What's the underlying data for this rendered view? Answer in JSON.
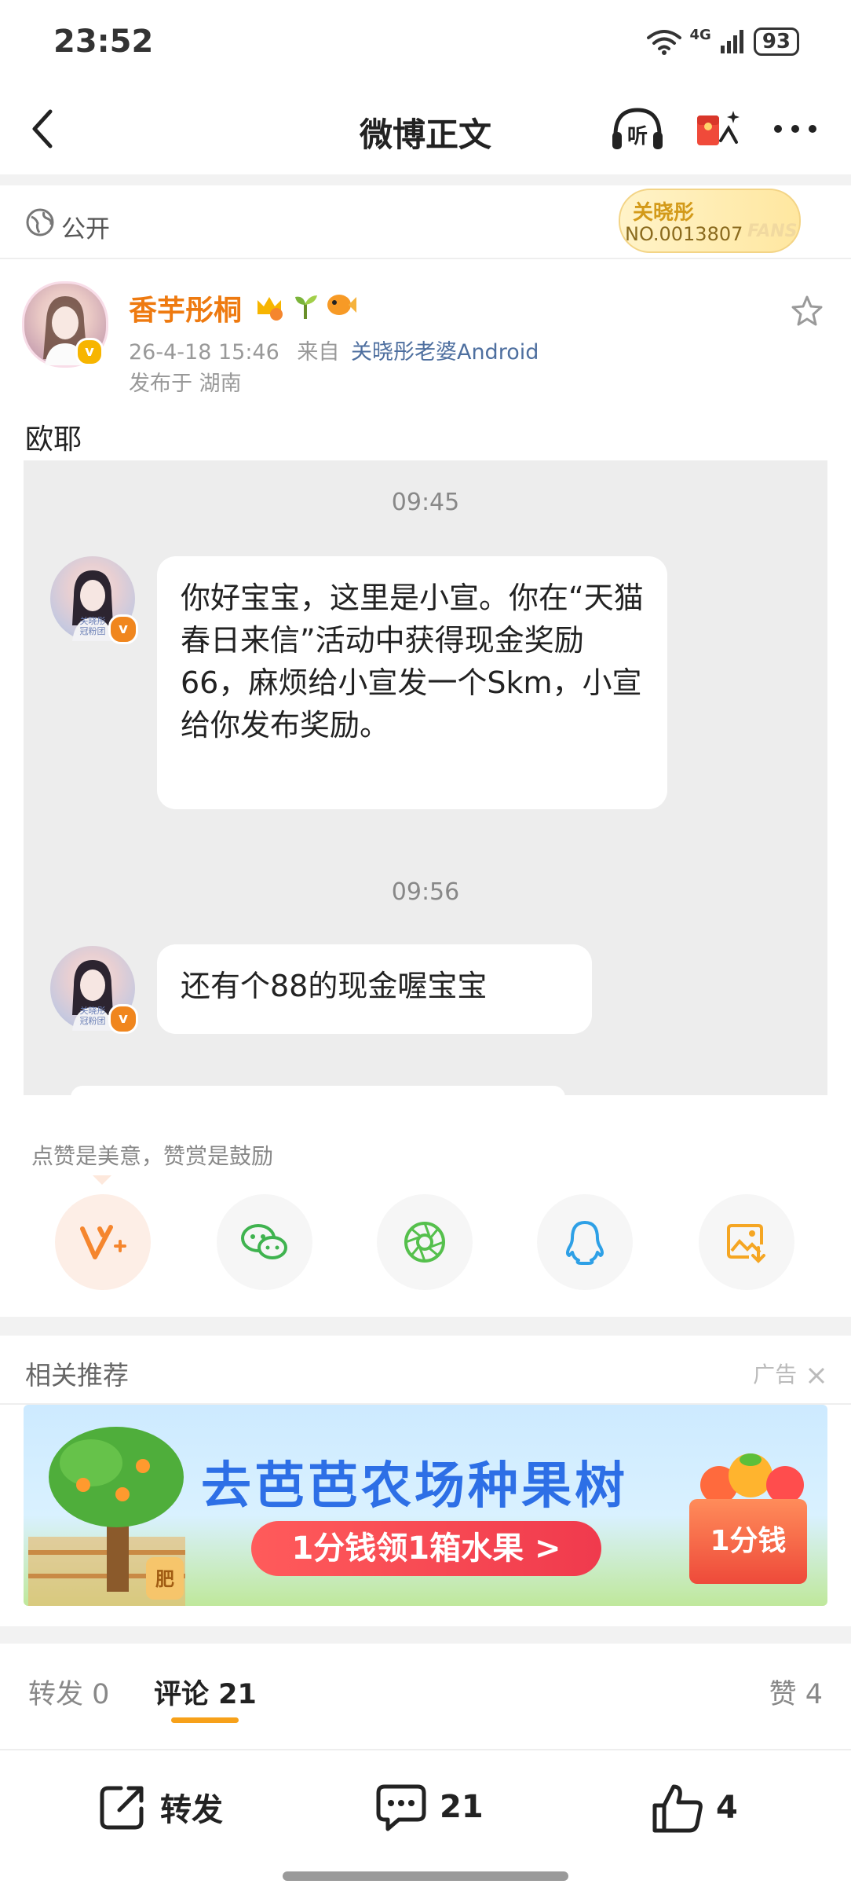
{
  "status_bar": {
    "time": "23:52",
    "network": "4G",
    "battery": "93"
  },
  "nav": {
    "title": "微博正文"
  },
  "visibility": {
    "label": "公开"
  },
  "fans_badge": {
    "name": "关晓彤",
    "number": "NO.0013807",
    "word": "FANS"
  },
  "author": {
    "name": "香芋彤桐",
    "date": "26-4-18 15:46",
    "from_prefix": "来自",
    "source": "关晓彤老婆Android",
    "location": "发布于 湖南"
  },
  "post": {
    "text": "欧耶"
  },
  "chat": {
    "messages": [
      {
        "time": "09:45",
        "text": "你好宝宝，这里是小宣。你在“天猫春日来信”活动中获得现金奖励66，麻烦给小宣发一个Skm，小宣给你发布奖励。",
        "avatar_caption": "关晓彤\n冠粉团"
      },
      {
        "time": "09:56",
        "text": "还有个88的现金喔宝宝",
        "avatar_caption": "关晓彤\n冠粉团"
      }
    ]
  },
  "reward": {
    "hint": "点赞是美意，赞赏是鼓励"
  },
  "share_icons": [
    "reward-v-icon",
    "wechat-icon",
    "moments-icon",
    "qq-icon",
    "save-image-icon"
  ],
  "recommend": {
    "title": "相关推荐",
    "ad_label": "广告",
    "banner": {
      "headline": "去芭芭农场种果树",
      "cta": "1分钱领1箱水果 >",
      "price_tag": "1分钱",
      "bag_label": "肥"
    }
  },
  "tabs": {
    "repost": "转发 0",
    "comment": "评论 21",
    "like": "赞 4"
  },
  "bottom_bar": {
    "repost": "转发",
    "comment": "21",
    "like": "4"
  },
  "colors": {
    "accent": "#f7a11a",
    "name": "#ee7a10",
    "link": "#4e6f9f",
    "verified": "#f7b500"
  }
}
